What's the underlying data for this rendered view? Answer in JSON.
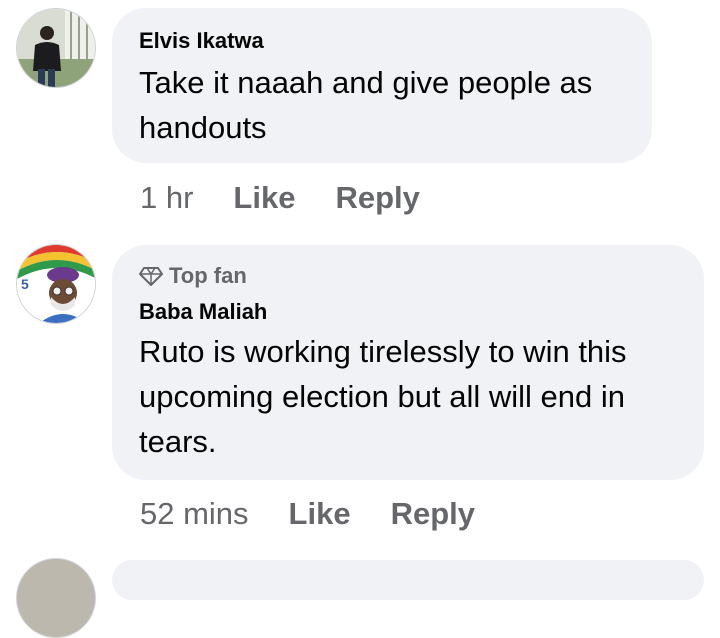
{
  "comments": [
    {
      "avatar_icon": "user-avatar-photo",
      "author": "Elvis Ikatwa",
      "text_lines": [
        "Take it naaah and give people as",
        "handouts"
      ],
      "time": "1 hr",
      "like": "Like",
      "reply": "Reply"
    },
    {
      "avatar_icon": "user-avatar-photo",
      "badge_icon": "diamond-icon",
      "badge": "Top fan",
      "author": "Baba Maliah",
      "text_lines": [
        "Ruto is working tirelessly to win this",
        "upcoming election but all will end in",
        "tears."
      ],
      "time": "52 mins",
      "like": "Like",
      "reply": "Reply"
    }
  ]
}
